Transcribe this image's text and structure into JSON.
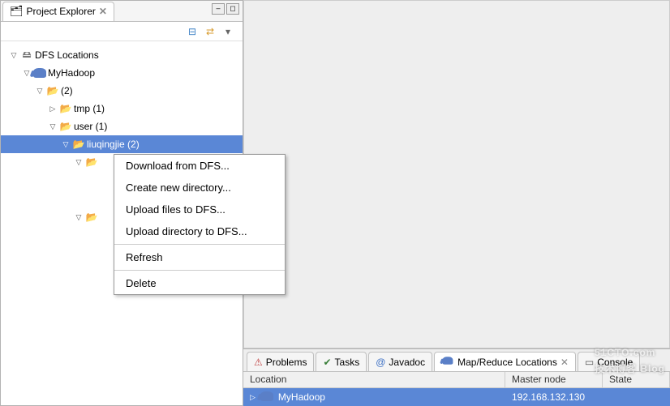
{
  "view": {
    "title": "Project Explorer",
    "minimize_tip": "Minimize",
    "maximize_tip": "Maximize"
  },
  "tree": {
    "root": {
      "label": "DFS Locations",
      "children": [
        {
          "label": "MyHadoop",
          "children": [
            {
              "label": "(2)",
              "children": [
                {
                  "label": "tmp (1)",
                  "expanded": false
                },
                {
                  "label": "user (1)",
                  "expanded": true,
                  "children": [
                    {
                      "label": "liuqingjie (2)",
                      "selected": true,
                      "children": [
                        {
                          "label": "",
                          "children": [
                            {
                              "label": ""
                            }
                          ]
                        },
                        {
                          "label": ""
                        }
                      ]
                    }
                  ]
                }
              ]
            }
          ]
        }
      ]
    }
  },
  "context_menu": {
    "items_group1": [
      "Download from DFS...",
      "Create new directory...",
      "Upload files to DFS...",
      "Upload directory to DFS..."
    ],
    "refresh": "Refresh",
    "delete": "Delete"
  },
  "bottom": {
    "tabs": [
      {
        "label": "Problems",
        "icon": "problems-icon"
      },
      {
        "label": "Tasks",
        "icon": "tasks-icon"
      },
      {
        "label": "Javadoc",
        "icon": "javadoc-icon"
      },
      {
        "label": "Map/Reduce Locations",
        "icon": "mapreduce-icon",
        "active": true,
        "closable": true
      },
      {
        "label": "Console",
        "icon": "console-icon"
      }
    ],
    "columns": {
      "location": "Location",
      "master": "Master node",
      "state": "State"
    },
    "rows": [
      {
        "location": "MyHadoop",
        "master": "192.168.132.130",
        "state": ""
      }
    ]
  },
  "watermark": {
    "main": "51CTO.com",
    "sub": "技术博客  Blog"
  }
}
